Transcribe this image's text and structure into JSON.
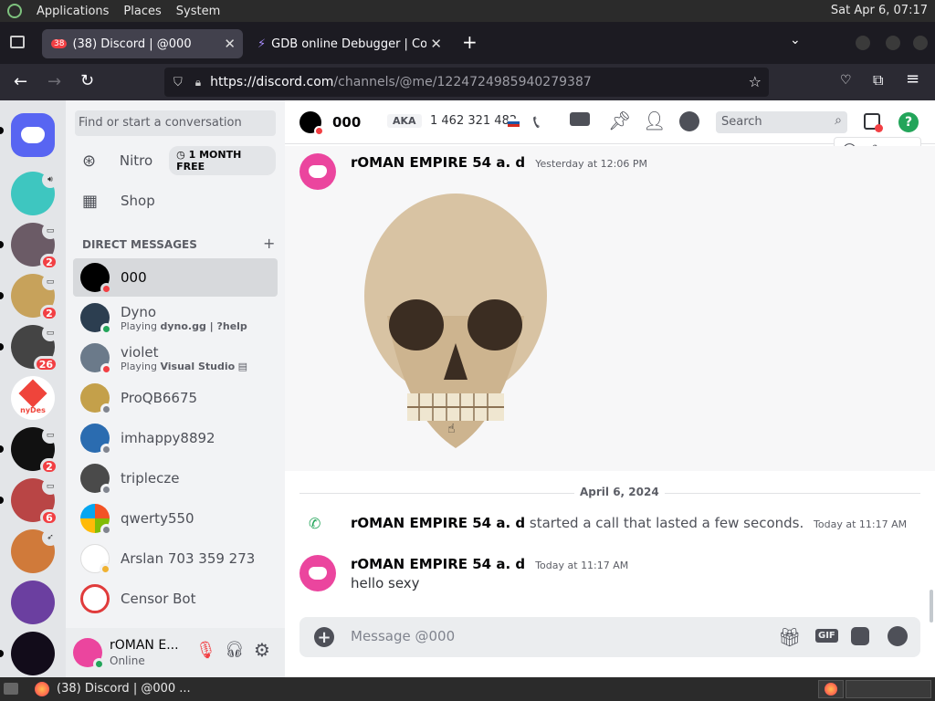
{
  "system": {
    "menus": [
      "Applications",
      "Places",
      "System"
    ],
    "clock": "Sat Apr  6, 07:17"
  },
  "browser": {
    "tabs": [
      {
        "badge": "38",
        "title": "(38) Discord | @000",
        "active": true
      },
      {
        "title": "GDB online Debugger | Com",
        "active": false
      }
    ],
    "url_host": "https://discord.com",
    "url_path": "/channels/@me/1224724985940279387"
  },
  "guilds": [
    {
      "name": "discord-home",
      "badge": "",
      "color": "#5865f2"
    },
    {
      "name": "server-1",
      "badge": "",
      "color": "#3ec6c0"
    },
    {
      "name": "server-2",
      "badge": "2",
      "color": "#6b5b66"
    },
    {
      "name": "server-3",
      "badge": "2",
      "color": "#c7a25b"
    },
    {
      "name": "server-4",
      "badge": "26",
      "color": "#444"
    },
    {
      "name": "anydesk",
      "badge": "",
      "color": "#ffffff",
      "label": "nyDes"
    },
    {
      "name": "server-6",
      "badge": "2",
      "color": "#111"
    },
    {
      "name": "server-7",
      "badge": "6",
      "color": "#b94545"
    },
    {
      "name": "server-8",
      "badge": "",
      "color": "#d07a3a"
    },
    {
      "name": "server-9",
      "badge": "",
      "color": "#6b3fa0"
    },
    {
      "name": "server-10",
      "badge": "",
      "color": "#120c1a"
    }
  ],
  "dm_panel": {
    "search_placeholder": "Find or start a conversation",
    "nitro": "Nitro",
    "nitro_badge": "1 MONTH FREE",
    "shop": "Shop",
    "section": "DIRECT MESSAGES",
    "items": [
      {
        "name": "000",
        "sub": "",
        "status": "#f23f43",
        "color": "#000000",
        "selected": true
      },
      {
        "name": "Dyno",
        "sub_prefix": "Playing ",
        "sub_bold": "dyno.gg | ?help",
        "status": "#23a55a",
        "color": "#2c3e50"
      },
      {
        "name": "violet",
        "sub_prefix": "Playing ",
        "sub_bold": "Visual Studio",
        "status": "#f23f43",
        "color": "#6b7a8a"
      },
      {
        "name": "ProQB6675",
        "sub": "",
        "status": "#80848e",
        "color": "#c4a04a"
      },
      {
        "name": "imhappy8892",
        "sub": "",
        "status": "#80848e",
        "color": "#2b6cb0"
      },
      {
        "name": "triplecze",
        "sub": "",
        "status": "#80848e",
        "color": "#4a4a4a"
      },
      {
        "name": "qwerty550",
        "sub": "",
        "status": "#80848e",
        "color": "#333"
      },
      {
        "name": "Arslan 703 359 273",
        "sub": "",
        "status": "#f0b232",
        "color": "#ffffff"
      },
      {
        "name": "Censor Bot",
        "sub": "",
        "status": "",
        "color": "#ffffff"
      }
    ],
    "user": {
      "name": "rOMAN E...",
      "status": "Online"
    }
  },
  "chat_header": {
    "name": "000",
    "aka": "AKA",
    "aka_value": "1 462 321 482",
    "search_placeholder": "Search"
  },
  "messages": [
    {
      "author": "rOMAN EMPIRE 54 a. d",
      "time": "Yesterday at 12:06 PM"
    },
    {
      "divider": "April 6, 2024"
    },
    {
      "author": "rOMAN EMPIRE 54 a. d",
      "call_text": "started a call that lasted a few seconds.",
      "time": "Today at 11:17 AM"
    },
    {
      "author": "rOMAN EMPIRE 54 a. d",
      "time": "Today at 11:17 AM",
      "text": "hello sexy"
    }
  ],
  "composer": {
    "placeholder": "Message @000",
    "gif": "GIF"
  },
  "taskbar": {
    "window_title": "(38) Discord | @000 ..."
  }
}
